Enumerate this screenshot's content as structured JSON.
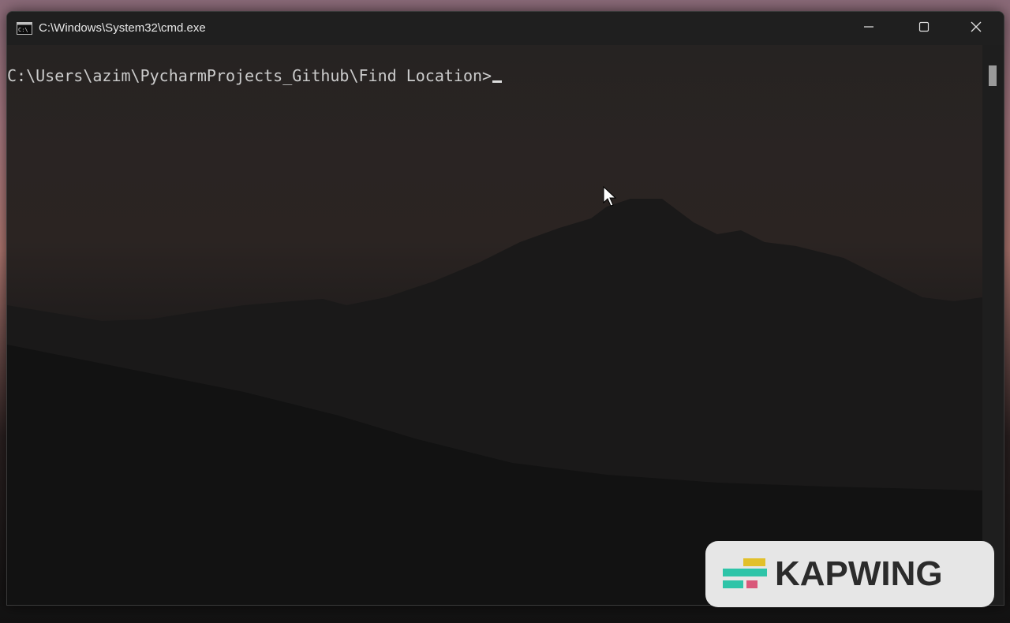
{
  "window": {
    "title": "C:\\Windows\\System32\\cmd.exe",
    "icon": "cmd-icon",
    "controls": {
      "minimize_icon": "minimize-icon",
      "maximize_icon": "maximize-icon",
      "close_icon": "close-icon"
    }
  },
  "console": {
    "prompt": "C:\\Users\\azim\\PycharmProjects_Github\\Find Location>",
    "text_color": "#cccccc"
  },
  "watermark": {
    "text": "KAPWING",
    "colors": {
      "yellow": "#e2c02a",
      "teal": "#2ec4a8",
      "pink": "#d9587a"
    }
  }
}
